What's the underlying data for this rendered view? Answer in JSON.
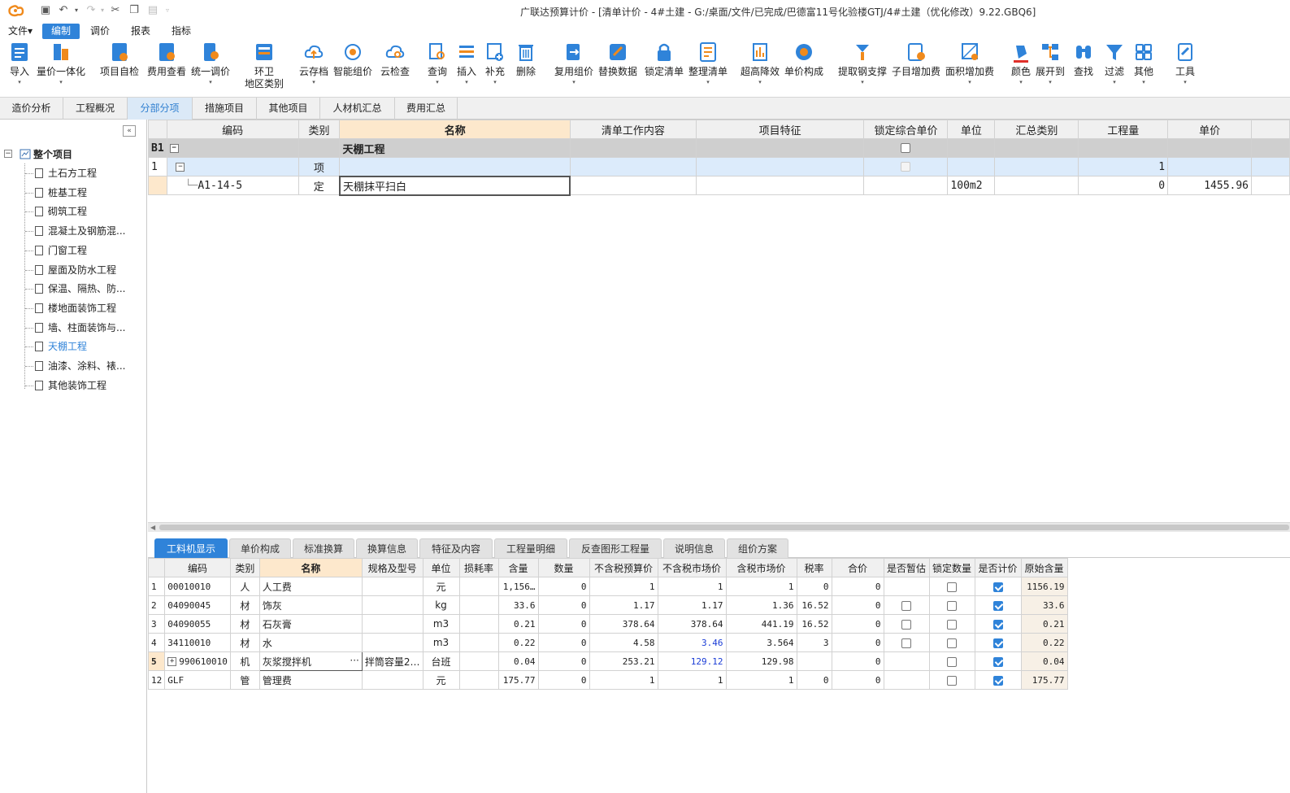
{
  "title": "广联达预算计价 - [清单计价 - 4#土建 - G:/桌面/文件/已完成/巴德富11号化验楼GTJ/4#土建（优化修改）9.22.GBQ6]",
  "menu": [
    "文件▾",
    "编制",
    "调价",
    "报表",
    "指标"
  ],
  "ribbon": {
    "import": "导入",
    "qty_price": "量价一体化",
    "self_check": "项目自检",
    "fee_view": "费用查看",
    "unify_price": "统一调价",
    "env_line1": "环卫",
    "env_line2": "地区类别",
    "cloud_save": "云存档",
    "smart_price": "智能组价",
    "cloud_check": "云检查",
    "query": "查询",
    "insert": "插入",
    "supplement": "补充",
    "delete": "删除",
    "reuse": "复用组价",
    "replace": "替换数据",
    "lock_list": "锁定清单",
    "arrange": "整理清单",
    "super_high": "超高降效",
    "unit_comp": "单价构成",
    "steel": "提取钢支撑",
    "sub_add": "子目增加费",
    "area_add": "面积增加费",
    "color": "颜色",
    "expand": "展开到",
    "find": "查找",
    "filter": "过滤",
    "other": "其他",
    "tools": "工具"
  },
  "module_tabs": [
    "造价分析",
    "工程概况",
    "分部分项",
    "措施项目",
    "其他项目",
    "人材机汇总",
    "费用汇总"
  ],
  "tree": {
    "root": "整个项目",
    "items": [
      "土石方工程",
      "桩基工程",
      "砌筑工程",
      "混凝土及钢筋混...",
      "门窗工程",
      "屋面及防水工程",
      "保温、隔热、防...",
      "楼地面装饰工程",
      "墙、柱面装饰与...",
      "天棚工程",
      "油漆、涂料、裱...",
      "其他装饰工程"
    ]
  },
  "upper_table": {
    "headers": [
      "编码",
      "类别",
      "名称",
      "清单工作内容",
      "项目特征",
      "锁定综合单价",
      "单位",
      "汇总类别",
      "工程量",
      "单价"
    ],
    "group": {
      "idx": "B1",
      "name": "天棚工程"
    },
    "item": {
      "idx": "1",
      "type": "项",
      "qty": "1"
    },
    "sub": {
      "code": "A1-14-5",
      "type": "定",
      "name": "天棚抹平扫白",
      "unit": "100m2",
      "qty": "0",
      "price": "1455.96"
    }
  },
  "lower_tabs": [
    "工料机显示",
    "单价构成",
    "标准换算",
    "换算信息",
    "特征及内容",
    "工程量明细",
    "反查图形工程量",
    "说明信息",
    "组价方案"
  ],
  "lower_table": {
    "headers": [
      "编码",
      "类别",
      "名称",
      "规格及型号",
      "单位",
      "损耗率",
      "含量",
      "数量",
      "不含税预算价",
      "不含税市场价",
      "含税市场价",
      "税率",
      "合价",
      "是否暂估",
      "锁定数量",
      "是否计价",
      "原始含量"
    ],
    "rows": [
      {
        "idx": "1",
        "code": "00010010",
        "type": "人",
        "name": "人工费",
        "spec": "",
        "unit": "元",
        "loss": "",
        "content": "1,156…",
        "num": "0",
        "budget": "1",
        "market": "1",
        "tax_market": "1",
        "rate": "0",
        "total": "0",
        "orig": "1156.19"
      },
      {
        "idx": "2",
        "code": "04090045",
        "type": "材",
        "name": "饰灰",
        "spec": "",
        "unit": "kg",
        "loss": "",
        "content": "33.6",
        "num": "0",
        "budget": "1.17",
        "market": "1.17",
        "tax_market": "1.36",
        "rate": "16.52",
        "total": "0",
        "orig": "33.6"
      },
      {
        "idx": "3",
        "code": "04090055",
        "type": "材",
        "name": "石灰膏",
        "spec": "",
        "unit": "m3",
        "loss": "",
        "content": "0.21",
        "num": "0",
        "budget": "378.64",
        "market": "378.64",
        "tax_market": "441.19",
        "rate": "16.52",
        "total": "0",
        "orig": "0.21"
      },
      {
        "idx": "4",
        "code": "34110010",
        "type": "材",
        "name": "水",
        "spec": "",
        "unit": "m3",
        "loss": "",
        "content": "0.22",
        "num": "0",
        "budget": "4.58",
        "market": "3.46",
        "tax_market": "3.564",
        "rate": "3",
        "total": "0",
        "orig": "0.22"
      },
      {
        "idx": "5",
        "code": "990610010",
        "type": "机",
        "name": "灰浆搅拌机",
        "spec": "拌筒容量2…",
        "unit": "台班",
        "loss": "",
        "content": "0.04",
        "num": "0",
        "budget": "253.21",
        "market": "129.12",
        "tax_market": "129.98",
        "rate": "",
        "total": "0",
        "orig": "0.04"
      },
      {
        "idx": "12",
        "code": "GLF",
        "type": "管",
        "name": "管理费",
        "spec": "",
        "unit": "元",
        "loss": "",
        "content": "175.77",
        "num": "0",
        "budget": "1",
        "market": "1",
        "tax_market": "1",
        "rate": "0",
        "total": "0",
        "orig": "175.77"
      }
    ]
  },
  "colors": {
    "accent": "#2f83d9",
    "header_highlight": "#fde8cc",
    "edited_value": "#1a3cd6"
  }
}
